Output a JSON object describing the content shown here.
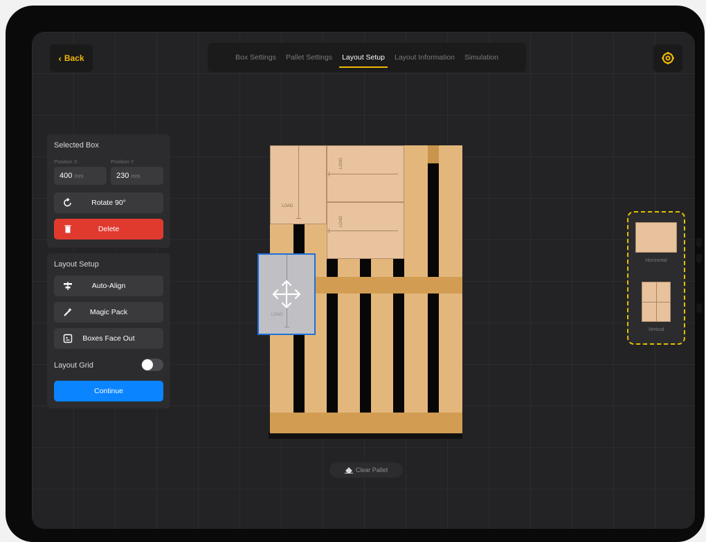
{
  "header": {
    "back_label": "Back",
    "tabs": [
      {
        "label": "Box Settings",
        "active": false
      },
      {
        "label": "Pallet Settings",
        "active": false
      },
      {
        "label": "Layout Setup",
        "active": true
      },
      {
        "label": "Layout Information",
        "active": false
      },
      {
        "label": "Simulation",
        "active": false
      }
    ],
    "settings_icon": "gear-icon"
  },
  "selected_box": {
    "title": "Selected Box",
    "position_x": {
      "label": "Position X",
      "value": "400",
      "unit": "mm"
    },
    "position_y": {
      "label": "Position Y",
      "value": "230",
      "unit": "mm"
    },
    "rotate_label": "Rotate 90°",
    "delete_label": "Delete"
  },
  "layout_setup": {
    "title": "Layout Setup",
    "auto_align_label": "Auto-Align",
    "magic_pack_label": "Magic Pack",
    "boxes_face_out_label": "Boxes Face Out",
    "layout_grid_label": "Layout Grid",
    "layout_grid_on": false,
    "continue_label": "Continue"
  },
  "canvas": {
    "box_label": "LOAD",
    "clear_pallet_label": "Clear Pallet"
  },
  "orientation": {
    "horizontal_label": "Horizontal",
    "vertical_label": "Vertical"
  },
  "colors": {
    "accent": "#f2b705",
    "delete": "#e03a2f",
    "continue": "#0a84ff",
    "selection": "#1e6fd9",
    "orientation_border": "#e5c200"
  }
}
